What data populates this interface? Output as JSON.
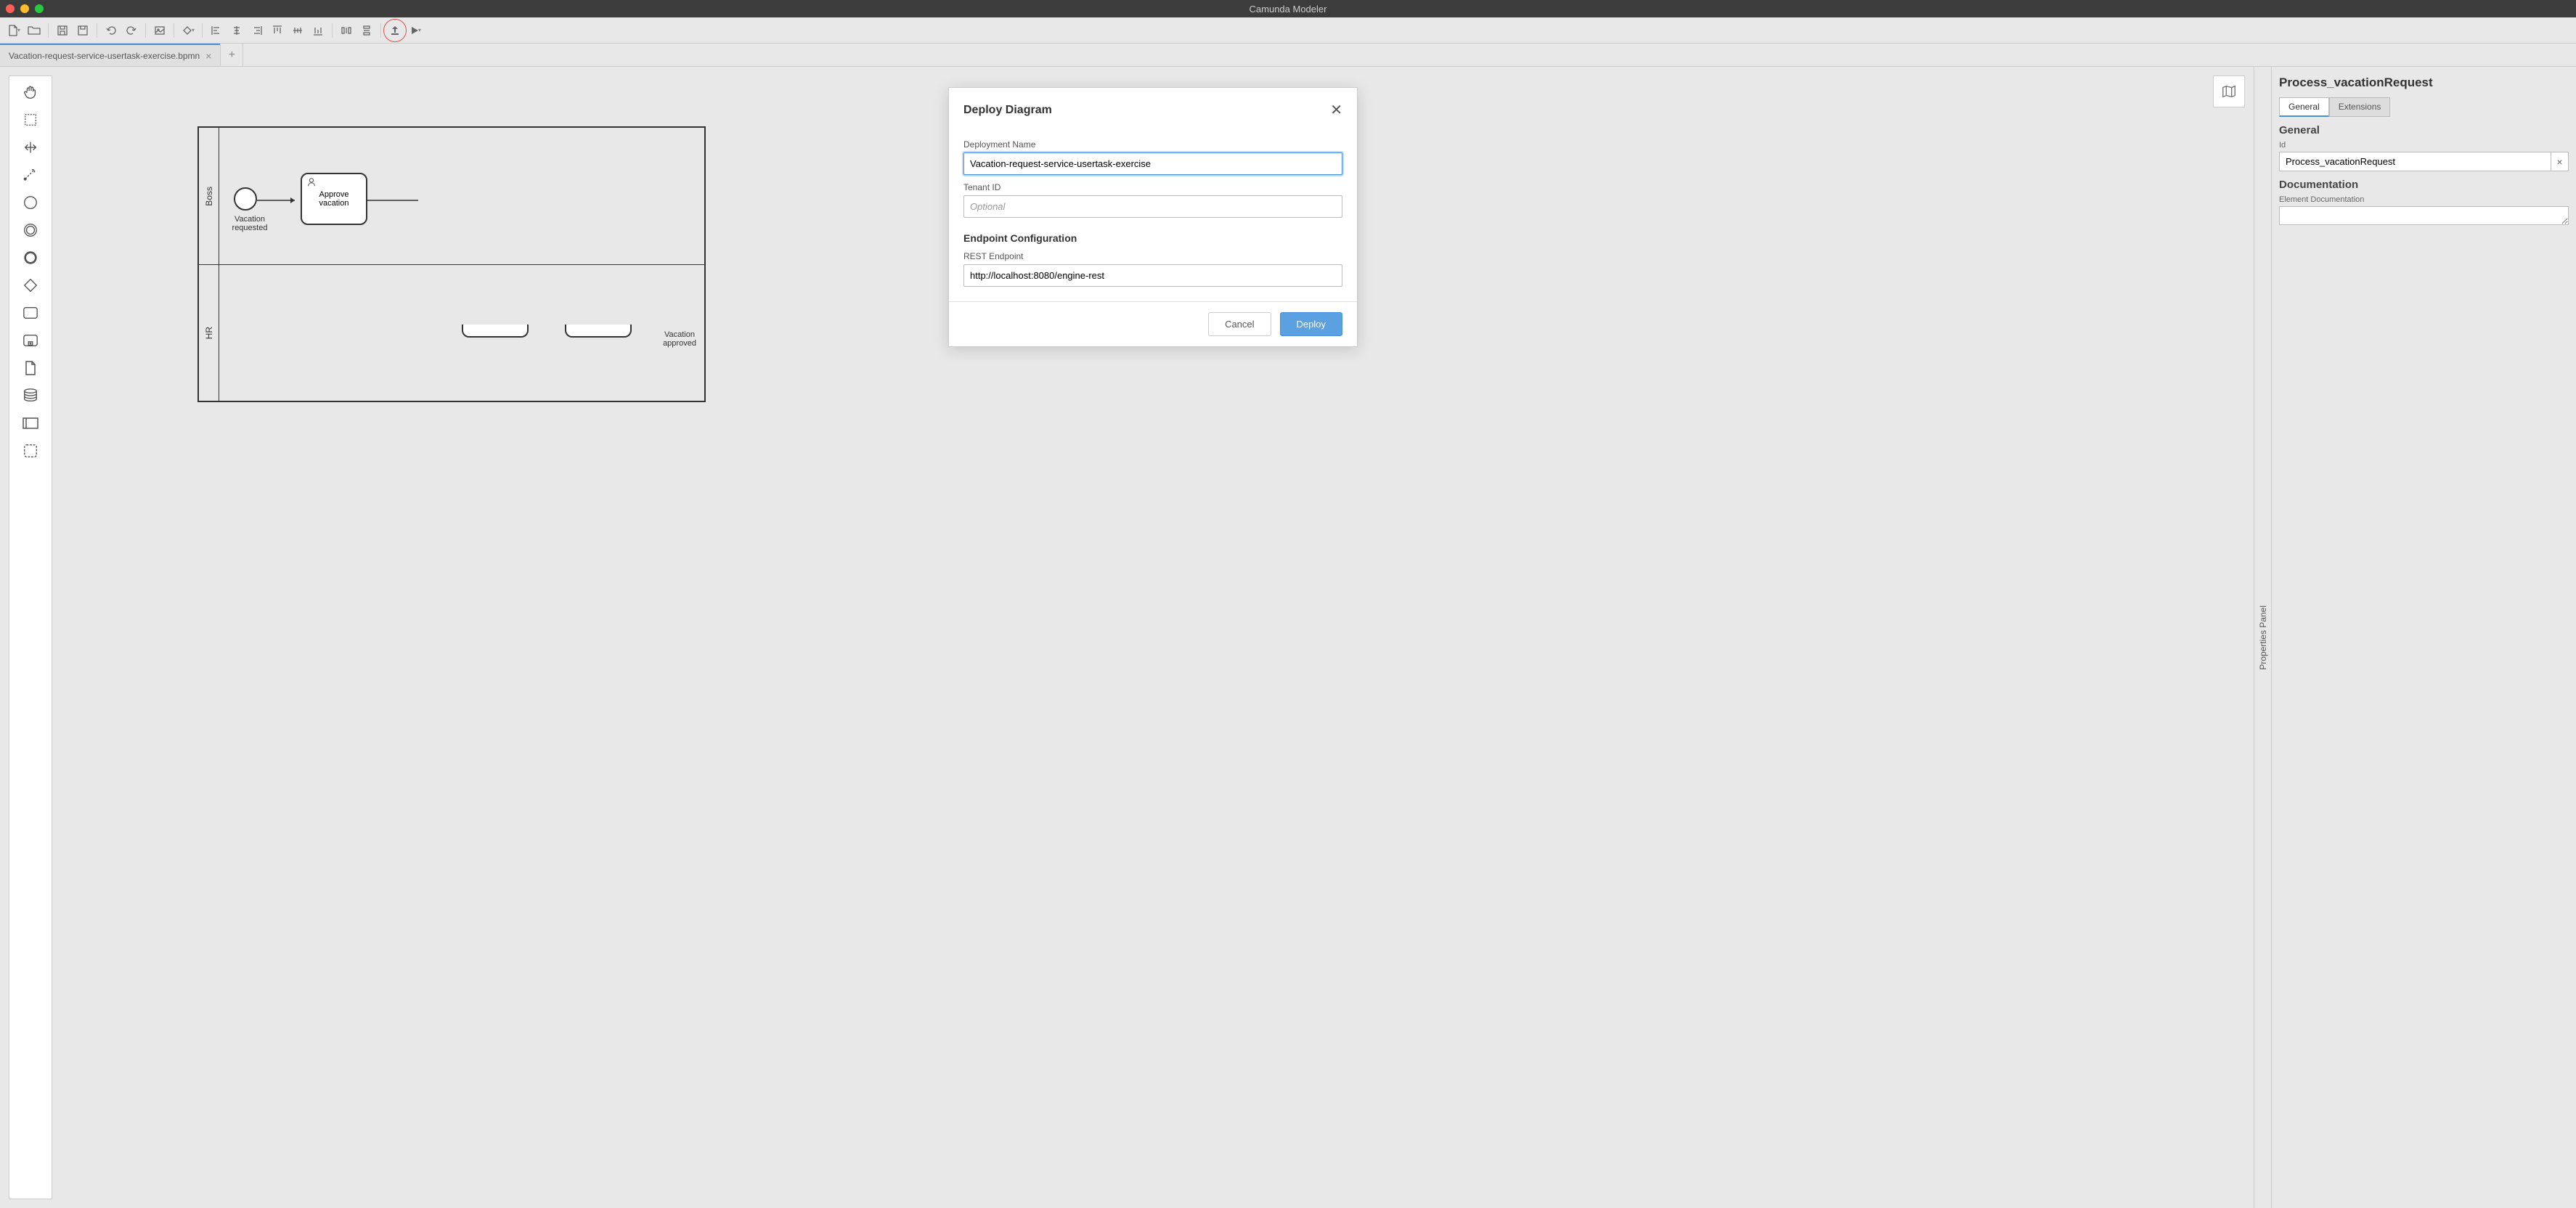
{
  "app": {
    "title": "Camunda Modeler"
  },
  "tabs": {
    "active": "Vacation-request-service-usertask-exercise.bpmn"
  },
  "palette": {
    "items": [
      "hand-tool",
      "lasso-tool",
      "space-tool",
      "connect-tool",
      "start-event",
      "intermediate-event",
      "end-event",
      "gateway",
      "task",
      "sub-process",
      "data-object",
      "data-store",
      "participant",
      "group"
    ]
  },
  "bpmn": {
    "lanes": [
      "Boss",
      "HR"
    ],
    "start_event_label": "Vacation requested",
    "user_task_label": "Approve vacation",
    "end_event_label": "Vacation approved"
  },
  "modal": {
    "title": "Deploy Diagram",
    "deployment_name_label": "Deployment Name",
    "deployment_name_value": "Vacation-request-service-usertask-exercise",
    "tenant_id_label": "Tenant ID",
    "tenant_id_placeholder": "Optional",
    "endpoint_section": "Endpoint Configuration",
    "rest_endpoint_label": "REST Endpoint",
    "rest_endpoint_value": "http://localhost:8080/engine-rest",
    "cancel": "Cancel",
    "deploy": "Deploy"
  },
  "props": {
    "title": "Process_vacationRequest",
    "tab_general": "General",
    "tab_extensions": "Extensions",
    "section_general": "General",
    "id_label": "Id",
    "id_value": "Process_vacationRequest",
    "section_doc": "Documentation",
    "doc_label": "Element Documentation",
    "panel_toggle": "Properties Panel"
  }
}
